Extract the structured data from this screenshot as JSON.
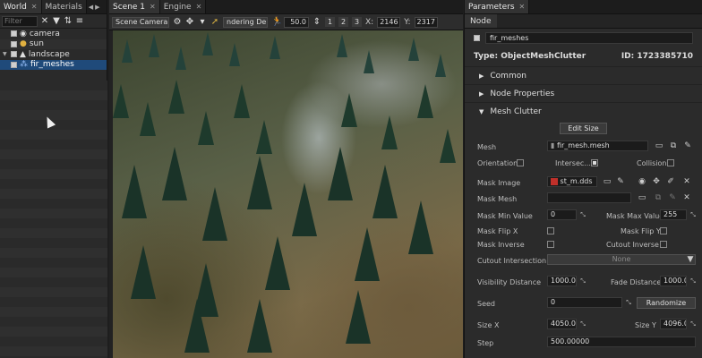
{
  "left_panel": {
    "tabs": [
      {
        "label": "World"
      },
      {
        "label": "Materials"
      }
    ],
    "filter_placeholder": "Filter",
    "tree": [
      {
        "label": "camera",
        "icon": "camera-icon"
      },
      {
        "label": "sun",
        "icon": "sun-icon"
      },
      {
        "label": "landscape",
        "icon": "terrain-icon"
      },
      {
        "label": "fir_meshes",
        "icon": "mesh-clutter-icon"
      }
    ]
  },
  "scene_panel": {
    "tabs": [
      {
        "label": "Scene 1"
      },
      {
        "label": "Engine"
      }
    ],
    "camera_dropdown": "Scene Camera",
    "render_mode_dropdown": "ndering Del",
    "speed_value": "50.0",
    "layout_buttons": [
      "1",
      "2",
      "3"
    ],
    "x_label": "X:",
    "x_value": "2146",
    "y_label": "Y:",
    "y_value": "2317"
  },
  "right_panel": {
    "tab_label": "Parameters",
    "subtab_label": "Node",
    "node_name": "fir_meshes",
    "type_text": "Type: ObjectMeshClutter",
    "id_text": "ID: 1723385710",
    "sections": {
      "common": "Common",
      "node_properties": "Node Properties",
      "mesh_clutter": "Mesh Clutter"
    },
    "edit_size_button": "Edit Size",
    "mesh_label": "Mesh",
    "mesh_value": "fir_mesh.mesh",
    "orientation_label": "Orientation",
    "intersection_label": "Intersec...",
    "collision_label": "Collision",
    "mask_image_label": "Mask Image",
    "mask_image_value": "st_m.dds",
    "mask_mesh_label": "Mask Mesh",
    "mask_min_label": "Mask Min Value",
    "mask_min_value": "0",
    "mask_max_label": "Mask Max Value",
    "mask_max_value": "255",
    "mask_flip_x_label": "Mask Flip X",
    "mask_flip_y_label": "Mask Flip Y",
    "mask_inverse_label": "Mask Inverse",
    "cutout_inverse_label": "Cutout Inverse",
    "cutout_intersection_label": "Cutout Intersection",
    "cutout_intersection_value": "None",
    "visibility_distance_label": "Visibility Distance",
    "visibility_distance_value": "1000.0",
    "fade_distance_label": "Fade Distance",
    "fade_distance_value": "1000.0",
    "seed_label": "Seed",
    "seed_value": "0",
    "randomize_button": "Randomize",
    "size_x_label": "Size X",
    "size_x_value": "4050.0",
    "size_y_label": "Size Y",
    "size_y_value": "4096.0",
    "step_label": "Step",
    "step_value": "500.00000"
  },
  "colors": {
    "selection": "#1f4a7a",
    "panel_bg": "#2b2b2b",
    "accent_red": "#c0302a"
  }
}
